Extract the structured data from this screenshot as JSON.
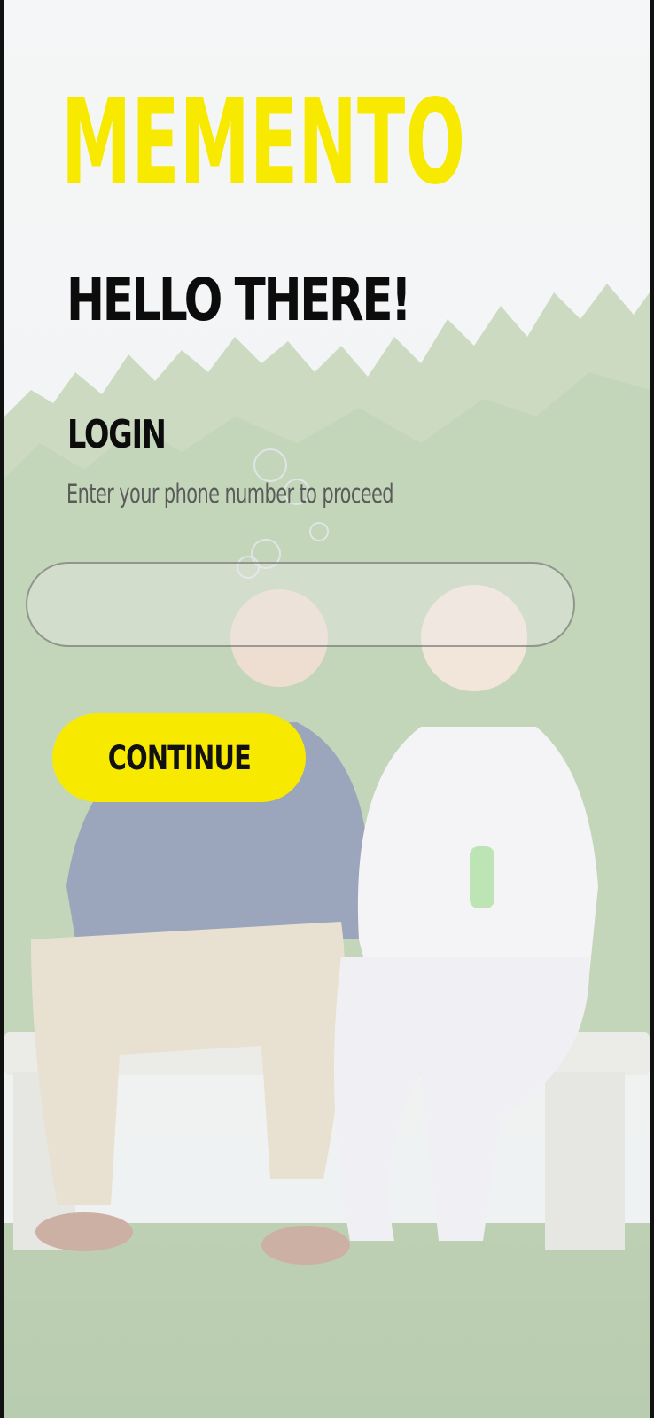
{
  "app": {
    "logo_text": "MEMENTO",
    "brand_color": "#F7EA00"
  },
  "login": {
    "greeting": "HELLO THERE!",
    "section_title": "LOGIN",
    "instruction": "Enter your phone number to proceed",
    "phone_input": {
      "value": "",
      "placeholder": ""
    },
    "continue_label": "CONTINUE"
  }
}
